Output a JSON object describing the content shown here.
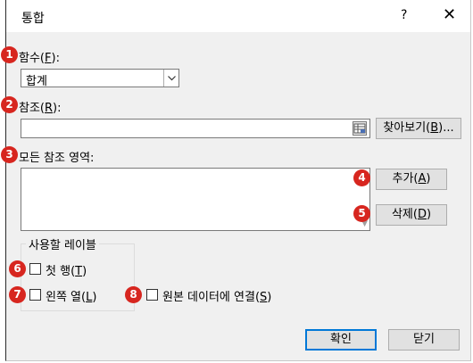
{
  "dialog": {
    "title": "통합",
    "help": "?",
    "close": "✕"
  },
  "badges": [
    "1",
    "2",
    "3",
    "4",
    "5",
    "6",
    "7",
    "8"
  ],
  "function": {
    "label": "함수",
    "accel": "F",
    "suffix": ":",
    "value": "합계"
  },
  "reference": {
    "label": "참조",
    "accel": "R",
    "suffix": ":",
    "value": "",
    "browse": {
      "text": "찾아보기",
      "accel": "B",
      "suffix": "..."
    }
  },
  "all_refs": {
    "label": "모든 참조 영역:",
    "add": {
      "text": "추가",
      "accel": "A"
    },
    "delete": {
      "text": "삭제",
      "accel": "D"
    }
  },
  "use_labels": {
    "title": "사용할 레이블",
    "top_row": {
      "text": "첫 행",
      "accel": "T",
      "checked": false
    },
    "left_column": {
      "text": "왼쪽 열",
      "accel": "L",
      "checked": false
    },
    "link_source": {
      "text": "원본 데이터에 연결",
      "accel": "S",
      "checked": false
    }
  },
  "buttons": {
    "ok": "확인",
    "close": "닫기"
  },
  "colors": {
    "badge": "#d7261f",
    "dialog_bg": "#f0f0f0",
    "default_border": "#0078d7"
  },
  "icons": [
    "chevron-down-icon",
    "range-select-icon",
    "close-icon"
  ]
}
